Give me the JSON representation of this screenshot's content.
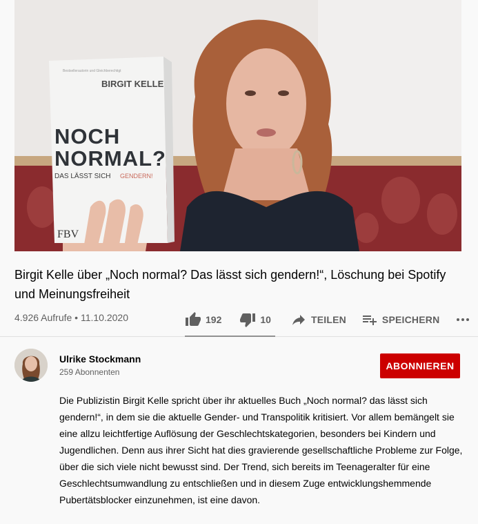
{
  "video": {
    "book": {
      "author": "BIRGIT KELLE",
      "tagline": "Bestsellerautorin und Gleichberechtigt",
      "title_line1": "NOCH",
      "title_line2": "NORMAL?",
      "subtitle": "DAS LÄSST SICH",
      "subtitle_accent": "GENDERN!",
      "publisher": "FBV"
    }
  },
  "title": "Birgit Kelle über „Noch normal? Das lässt sich gendern!“, Löschung bei Spotify und Meinungsfreiheit",
  "meta": {
    "views_date": "4.926 Aufrufe • 11.10.2020"
  },
  "actions": {
    "likes": "192",
    "dislikes": "10",
    "share_label": "TEILEN",
    "save_label": "SPEICHERN",
    "more_icon": "more-horizontal-icon"
  },
  "sentiment": {
    "like_fraction": 0.95
  },
  "channel": {
    "name": "Ulrike Stockmann",
    "subscribers": "259 Abonnenten",
    "subscribe_label": "ABONNIEREN"
  },
  "description": "Die Publizistin Birgit Kelle spricht über ihr aktuelles Buch „Noch normal? das lässt sich gendern!“, in dem sie die aktuelle Gender- und Transpolitik kritisiert. Vor allem bemängelt sie eine allzu leichtfertige Auflösung der Geschlechtskategorien, besonders bei Kindern und Jugendlichen. Denn aus ihrer Sicht hat dies gravierende gesellschaftliche Probleme zur Folge, über die sich viele nicht bewusst sind. Der Trend, sich bereits im Teenageralter für eine Geschlechtsumwandlung zu entschließen und in diesem Zuge entwicklungshemmende Pubertätsblocker einzunehmen, ist eine davon.",
  "colors": {
    "subscribe": "#cc0000",
    "secondary_text": "#606060"
  }
}
